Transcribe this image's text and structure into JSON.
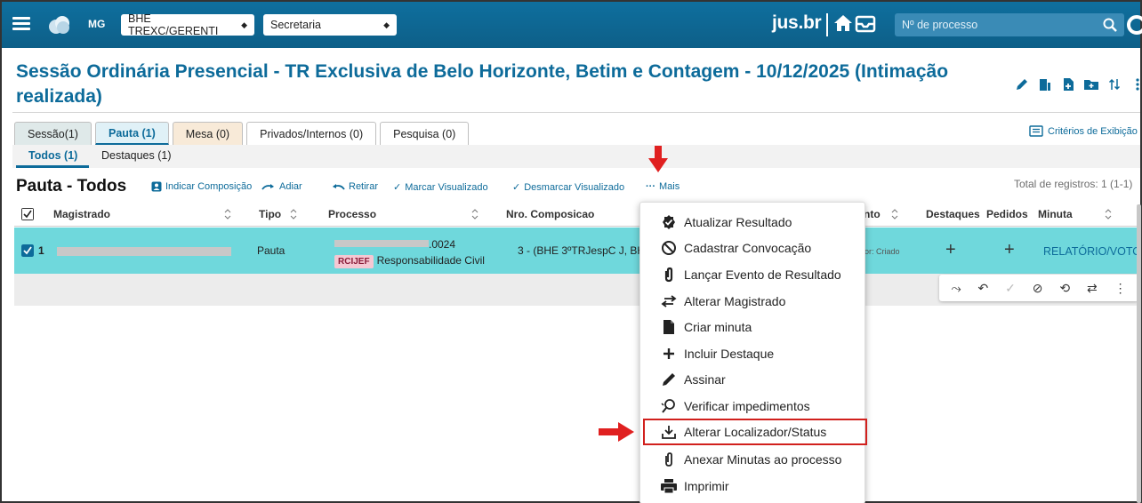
{
  "topbar": {
    "uf": "MG",
    "orgao_select": "BHE TREXC/GERENTI",
    "secretaria_select": "Secretaria",
    "brand": "jus.br",
    "process_placeholder": "Nº de processo"
  },
  "title": "Sessão Ordinária Presencial - TR Exclusiva de Belo Horizonte, Betim e Contagem - 10/12/2025 (Intimação realizada)",
  "tabs": [
    "Sessão(1)",
    "Pauta (1)",
    "Mesa (0)",
    "Privados/Internos (0)",
    "Pesquisa (0)"
  ],
  "criterios": "Critérios de Exibição",
  "subtabs": [
    "Todos (1)",
    "Destaques (1)"
  ],
  "page_heading": "Pauta - Todos",
  "toolbar": {
    "indicar": "Indicar Composição",
    "adiar": "Adiar",
    "retirar": "Retirar",
    "marcar": "Marcar Visualizado",
    "desmarcar": "Desmarcar Visualizado",
    "mais": "Mais"
  },
  "total": "Total de registros: 1 (1-1)",
  "table": {
    "headers": {
      "magistrado": "Magistrado",
      "tipo": "Tipo",
      "processo": "Processo",
      "composicao": "Nro. Composicao",
      "resultado": "nto",
      "destaques": "Destaques",
      "pedidos": "Pedidos",
      "minuta": "Minuta"
    },
    "row": {
      "num": "1",
      "tipo": "Pauta",
      "processo_suffix": ".0024",
      "classe_tag": "RCIJEF",
      "assunto": "Responsabilidade Civil",
      "composicao": "3 - (BHE 3ºTRJespC J, BH",
      "resultado": "or: Criado",
      "destaque_add": "+",
      "pedido_add": "+",
      "minuta": "RELATÓRIO/VOTO"
    }
  },
  "menu": {
    "items": [
      {
        "label": "Atualizar Resultado",
        "icon": "badge-check-icon"
      },
      {
        "label": "Cadastrar Convocação",
        "icon": "ban-icon"
      },
      {
        "label": "Lançar Evento de Resultado",
        "icon": "paperclip-icon"
      },
      {
        "label": "Alterar Magistrado",
        "icon": "swap-icon"
      },
      {
        "label": "Criar minuta",
        "icon": "file-icon"
      },
      {
        "label": "Incluir Destaque",
        "icon": "plus-icon"
      },
      {
        "label": "Assinar",
        "icon": "pen-icon"
      },
      {
        "label": "Verificar impedimentos",
        "icon": "search-person-icon"
      },
      {
        "label": "Alterar Localizador/Status",
        "icon": "download-tray-icon"
      },
      {
        "label": "Anexar Minutas ao processo",
        "icon": "paperclip-icon"
      },
      {
        "label": "Imprimir",
        "icon": "printer-icon"
      }
    ]
  },
  "colors": {
    "topbar": "#0f6f9e",
    "accent": "#0d6b9a",
    "row_selected": "#6fd8dc",
    "highlight": "#d1201d"
  }
}
